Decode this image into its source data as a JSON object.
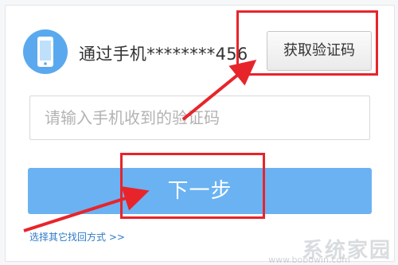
{
  "verify": {
    "phone_label": "通过手机********456",
    "get_code_label": "获取验证码",
    "code_placeholder": "请输入手机收到的验证码",
    "code_value": "",
    "next_label": "下一步",
    "other_method_label": "选择其它找回方式 >>"
  },
  "icons": {
    "phone": "mobile-phone-icon"
  },
  "annotation_color": "#e8242b",
  "watermark": {
    "text": "系统家园",
    "url": "www.bobowin.com"
  }
}
